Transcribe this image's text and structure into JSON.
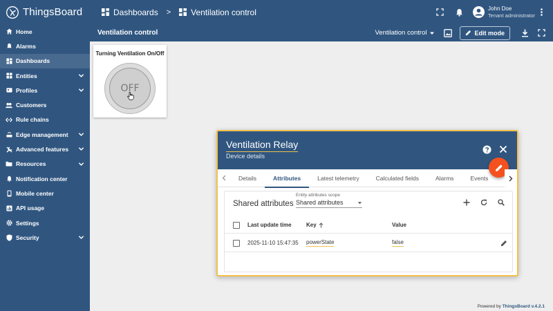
{
  "app": {
    "name": "ThingsBoard"
  },
  "breadcrumb": {
    "dashboards": "Dashboards",
    "separator": ">",
    "current": "Ventilation control"
  },
  "user": {
    "name": "John Doe",
    "role": "Tenant administrator"
  },
  "sidebar": {
    "items": [
      {
        "label": "Home"
      },
      {
        "label": "Alarms"
      },
      {
        "label": "Dashboards"
      },
      {
        "label": "Entities"
      },
      {
        "label": "Profiles"
      },
      {
        "label": "Customers"
      },
      {
        "label": "Rule chains"
      },
      {
        "label": "Edge management"
      },
      {
        "label": "Advanced features"
      },
      {
        "label": "Resources"
      },
      {
        "label": "Notification center"
      },
      {
        "label": "Mobile center"
      },
      {
        "label": "API usage"
      },
      {
        "label": "Settings"
      },
      {
        "label": "Security"
      }
    ]
  },
  "dashboard": {
    "title": "Ventilation control",
    "state": "Ventilation control",
    "edit_label": "Edit mode"
  },
  "widget": {
    "title": "Turning Ventilation On/Off",
    "knob_label": "OFF"
  },
  "dialog": {
    "title": "Ventilation Relay",
    "subtitle": "Device details",
    "tabs": [
      "Details",
      "Attributes",
      "Latest telemetry",
      "Calculated fields",
      "Alarms",
      "Events"
    ],
    "active_tab": "Attributes",
    "section_title": "Shared attributes",
    "scope": {
      "label": "Entity attributes scope",
      "value": "Shared attributes"
    },
    "table": {
      "headers": {
        "time": "Last update time",
        "key": "Key",
        "value": "Value"
      },
      "rows": [
        {
          "time": "2025-11-10 15:47:35",
          "key": "powerState",
          "value": "false"
        }
      ]
    }
  },
  "footer": {
    "prefix": "Powered by",
    "brand": "ThingsBoard v.4.2.1"
  },
  "colors": {
    "primary": "#305680",
    "accent": "#f4511e",
    "highlight": "#f2c14b"
  }
}
